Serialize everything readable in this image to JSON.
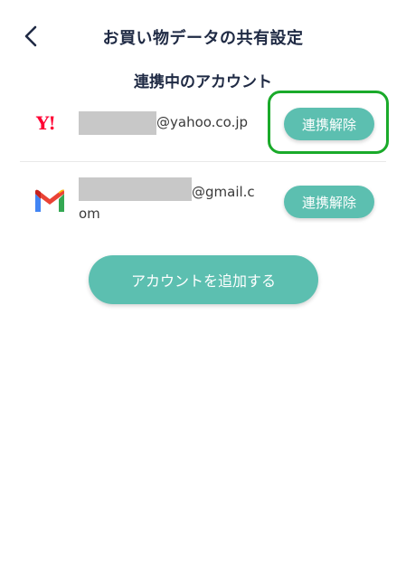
{
  "header": {
    "title": "お買い物データの共有設定",
    "back_icon": "chevron-left-icon"
  },
  "section": {
    "title": "連携中のアカウント"
  },
  "accounts": [
    {
      "provider": "Yahoo",
      "logo_text": "Y!",
      "email_suffix": "@yahoo.co.jp",
      "unlink_label": "連携解除"
    },
    {
      "provider": "Gmail",
      "email_suffix_line1": "@gmail.c",
      "email_suffix_line2": "om",
      "unlink_label": "連携解除"
    }
  ],
  "actions": {
    "add_account_label": "アカウントを追加する"
  },
  "colors": {
    "accent": "#5cbfb0",
    "text": "#1f2a44",
    "yahoo_red": "#ff0033",
    "highlight_green": "#1aaa2a",
    "mask_gray": "#c8c8c8"
  }
}
